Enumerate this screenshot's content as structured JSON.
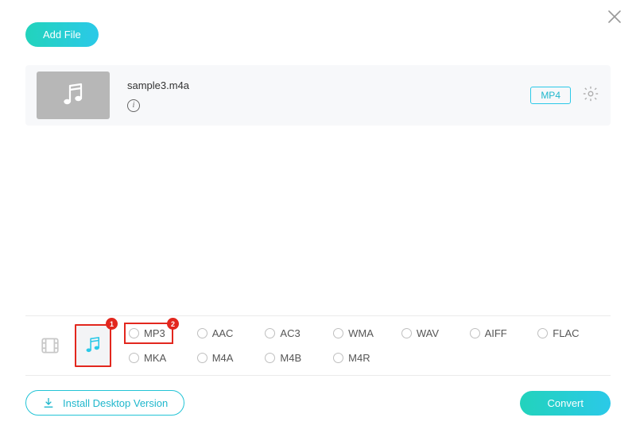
{
  "add_file_label": "Add File",
  "file": {
    "name": "sample3.m4a",
    "output_format": "MP4"
  },
  "callouts": {
    "one": "1",
    "two": "2"
  },
  "formats": {
    "row1": [
      "MP3",
      "AAC",
      "AC3",
      "WMA",
      "WAV",
      "AIFF",
      "FLAC"
    ],
    "row2": [
      "MKA",
      "M4A",
      "M4B",
      "M4R"
    ]
  },
  "footer": {
    "install_label": "Install Desktop Version",
    "convert_label": "Convert"
  }
}
